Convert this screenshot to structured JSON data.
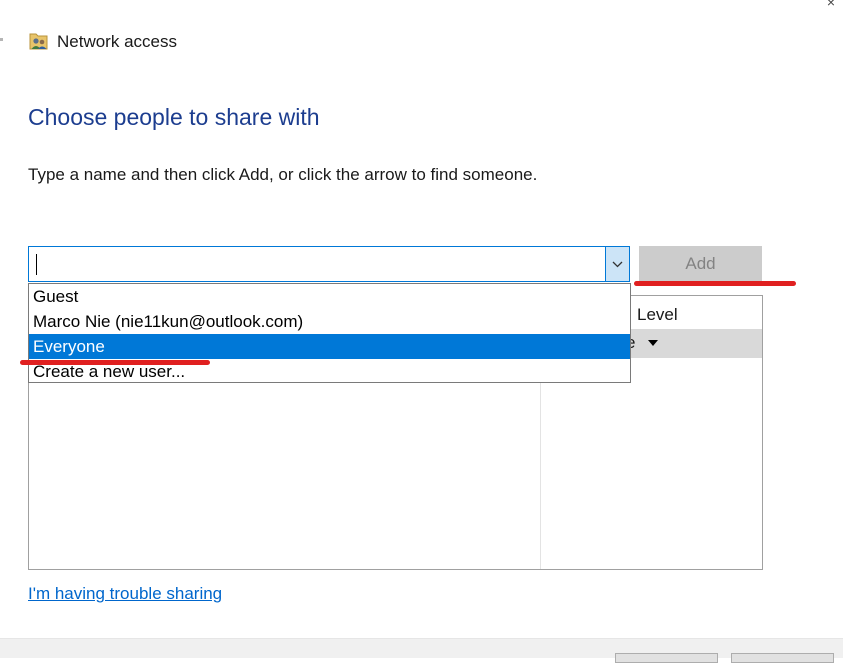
{
  "window": {
    "title": "Network access",
    "title_icon": "users-folder-icon",
    "corner_glyph": "×"
  },
  "main": {
    "heading": "Choose people to share with",
    "instruction": "Type a name and then click Add, or click the arrow to find someone.",
    "name_combo": {
      "value": "",
      "arrow_icon": "chevron-down-icon"
    },
    "add_label": "Add",
    "permission_header": "Level",
    "permission_row_text": "e"
  },
  "dropdown": {
    "items": [
      {
        "label": "Guest",
        "selected": false
      },
      {
        "label": "Marco Nie (nie11kun@outlook.com)",
        "selected": false
      },
      {
        "label": "Everyone",
        "selected": true
      },
      {
        "label": "Create a new user...",
        "selected": false
      }
    ]
  },
  "trouble_link": "I'm having trouble sharing",
  "colors": {
    "heading": "#1c3d8f",
    "selection": "#0078d7",
    "annotation": "#e02020",
    "link": "#0066cc"
  }
}
